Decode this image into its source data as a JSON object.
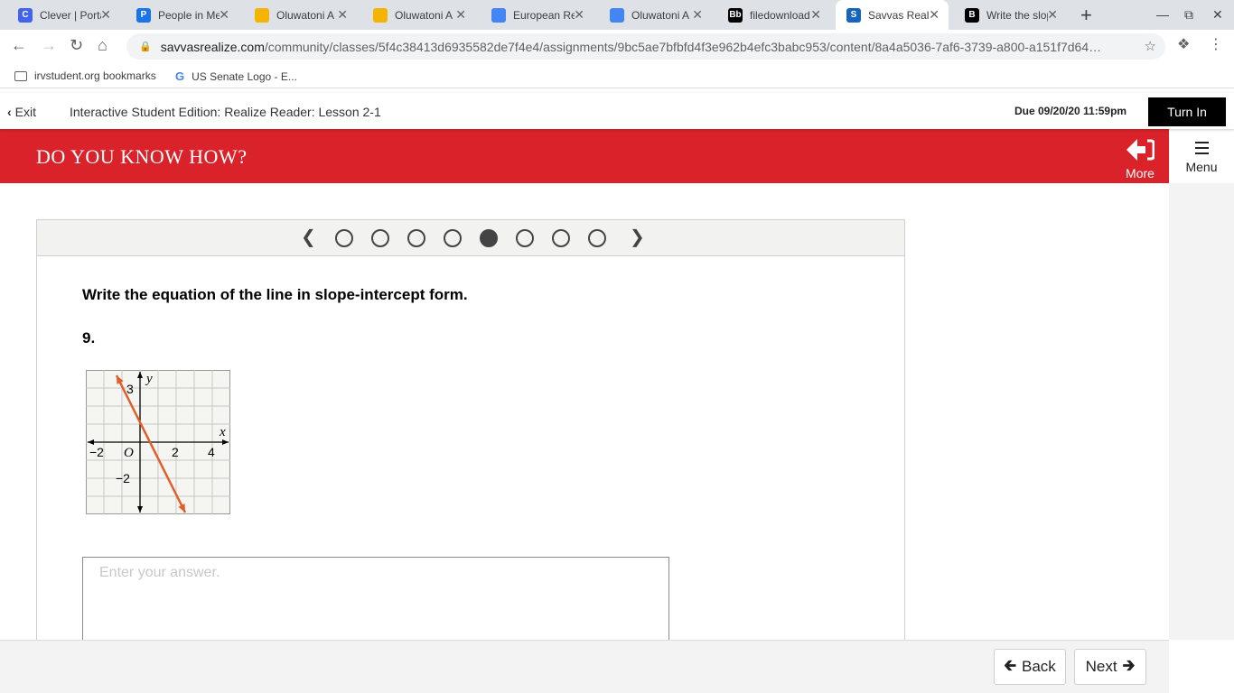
{
  "browser": {
    "tabs": [
      {
        "title": "Clever | Portal",
        "icon": "clever-icon",
        "color": "#4263eb",
        "glyph": "C"
      },
      {
        "title": "People in Me",
        "icon": "contacts-icon",
        "color": "#1a73e8",
        "glyph": "P"
      },
      {
        "title": "Oluwatoni A",
        "icon": "slides-icon",
        "color": "#f4b400",
        "glyph": ""
      },
      {
        "title": "Oluwatoni A",
        "icon": "slides-icon",
        "color": "#f4b400",
        "glyph": ""
      },
      {
        "title": "European Re",
        "icon": "docs-icon",
        "color": "#4285f4",
        "glyph": ""
      },
      {
        "title": "Oluwatoni A",
        "icon": "docs-icon",
        "color": "#4285f4",
        "glyph": ""
      },
      {
        "title": "filedownload",
        "icon": "blackboard-icon",
        "color": "#000000",
        "glyph": "Bb"
      },
      {
        "title": "Savvas Realize",
        "icon": "savvas-icon",
        "color": "#1565c0",
        "glyph": "S"
      },
      {
        "title": "Write the slope",
        "icon": "brainly-icon",
        "color": "#000000",
        "glyph": "B"
      }
    ],
    "url_host": "savvasrealize.com",
    "url_path": "/community/classes/5f4c38413d6935582de7f4e4/assignments/9bc5ae7bfbfd4f3e962b4efc3babc953/content/8a4a5036-7af6-3739-a800-a151f7d64…",
    "bookmarks": [
      {
        "label": "irvstudent.org bookmarks",
        "icon": "folder-icon"
      },
      {
        "label": "US Senate Logo - E...",
        "icon": "google-icon"
      }
    ]
  },
  "header": {
    "exit_label": "Exit",
    "lesson_title": "Interactive Student Edition: Realize Reader: Lesson 2-1",
    "due": "Due 09/20/20 11:59pm",
    "turn_in_label": "Turn In"
  },
  "banner": {
    "title": "DO YOU KNOW HOW?",
    "more_label": "More",
    "menu_label": "Menu",
    "color": "#d9222a"
  },
  "pager": {
    "total": 8,
    "current_index": 4
  },
  "question": {
    "prompt": "Write the equation of the line in slope-intercept form.",
    "number": "9.",
    "answer_placeholder": "Enter your answer."
  },
  "graph": {
    "axis_x_label": "x",
    "axis_y_label": "y",
    "origin_label": "O",
    "x_ticks": [
      "−2",
      "2",
      "4"
    ],
    "y_ticks": [
      "3",
      "−2"
    ],
    "line_color": "#e35d2b",
    "line_start": [
      -1.3,
      3.7
    ],
    "line_end": [
      2.5,
      -3.9
    ]
  },
  "footer": {
    "back_label": "Back",
    "next_label": "Next"
  }
}
